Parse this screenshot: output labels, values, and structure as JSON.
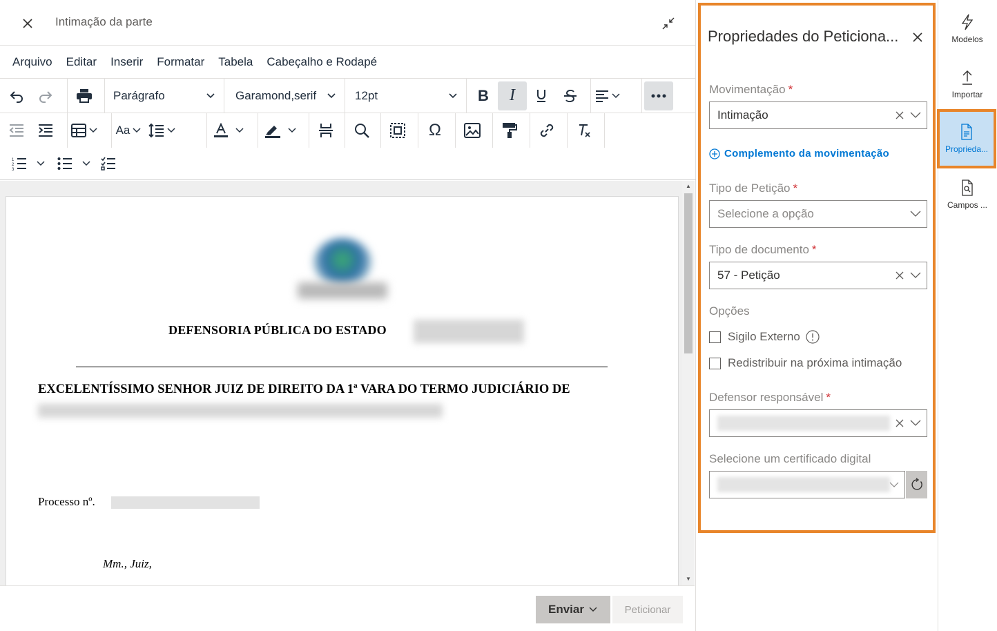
{
  "editor": {
    "title": "Intimação da parte",
    "menu": [
      "Arquivo",
      "Editar",
      "Inserir",
      "Formatar",
      "Tabela",
      "Cabeçalho e Rodapé"
    ],
    "toolbar": {
      "block_format": "Parágrafo",
      "font_family": "Garamond,serif",
      "font_size": "12pt",
      "font_case_label": "Aa"
    },
    "document": {
      "org_title": "DEFENSORIA PÚBLICA DO ESTADO",
      "addressee": "EXCELENTÍSSIMO SENHOR JUIZ DE DIREITO DA 1ª VARA DO TERMO JUDICIÁRIO DE",
      "process_label": "Processo nº.",
      "salutation": "Mm., Juiz,"
    },
    "footer": {
      "send_label": "Enviar",
      "petition_label": "Peticionar"
    }
  },
  "properties": {
    "title": "Propriedades do Peticiona...",
    "movimentacao": {
      "label": "Movimentação",
      "value": "Intimação"
    },
    "complement_link": "Complemento da movimentação",
    "tipo_peticao": {
      "label": "Tipo de Petição",
      "placeholder": "Selecione a opção"
    },
    "tipo_documento": {
      "label": "Tipo de documento",
      "value": "57 - Petição"
    },
    "options": {
      "label": "Opções",
      "sigilo": "Sigilo Externo",
      "redistribuir": "Redistribuir na próxima intimação"
    },
    "defensor": {
      "label": "Defensor responsável"
    },
    "certificado": {
      "label": "Selecione um certificado digital"
    },
    "required_mark": "*"
  },
  "rail": [
    {
      "label": "Modelos",
      "icon": "lightning-icon"
    },
    {
      "label": "Importar",
      "icon": "upload-icon"
    },
    {
      "label": "Proprieda...",
      "icon": "document-properties-icon",
      "active": true
    },
    {
      "label": "Campos ...",
      "icon": "document-search-icon"
    }
  ],
  "colors": {
    "highlight": "#e8852a",
    "accent": "#0078d4",
    "required": "#d13438"
  }
}
